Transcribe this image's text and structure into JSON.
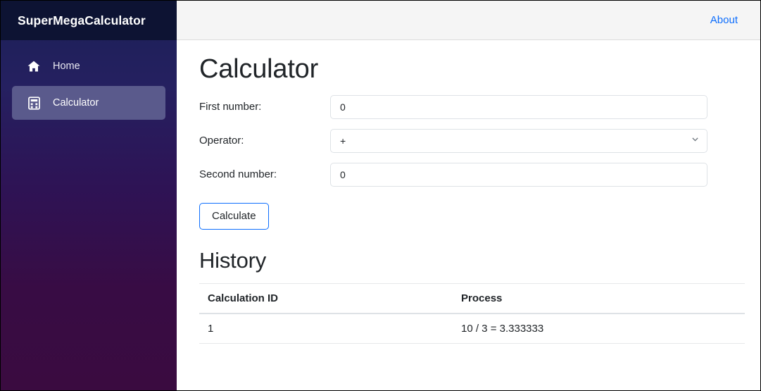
{
  "sidebar": {
    "brand": "SuperMegaCalculator",
    "items": [
      {
        "label": "Home",
        "icon": "home-icon",
        "active": false
      },
      {
        "label": "Calculator",
        "icon": "calculator-icon",
        "active": true
      }
    ]
  },
  "topbar": {
    "about_link": "About"
  },
  "main": {
    "page_title": "Calculator",
    "form": {
      "first_number": {
        "label": "First number:",
        "value": "0",
        "placeholder": "0"
      },
      "operator": {
        "label": "Operator:",
        "value": "+",
        "options": [
          "+",
          "-",
          "*",
          "/"
        ]
      },
      "second_number": {
        "label": "Second number:",
        "value": "0",
        "placeholder": "0"
      },
      "submit_label": "Calculate"
    },
    "history": {
      "title": "History",
      "columns": [
        "Calculation ID",
        "Process"
      ],
      "rows": [
        {
          "id": "1",
          "process": "10 / 3 = 3.333333"
        }
      ]
    }
  },
  "colors": {
    "brand_bg": "#0d1333",
    "sidebar_top": "#1b2157",
    "sidebar_bottom": "#3a0b40",
    "active_item": "#5a5a8c",
    "link_blue": "#0d6efd",
    "topbar_bg": "#f5f5f5"
  }
}
